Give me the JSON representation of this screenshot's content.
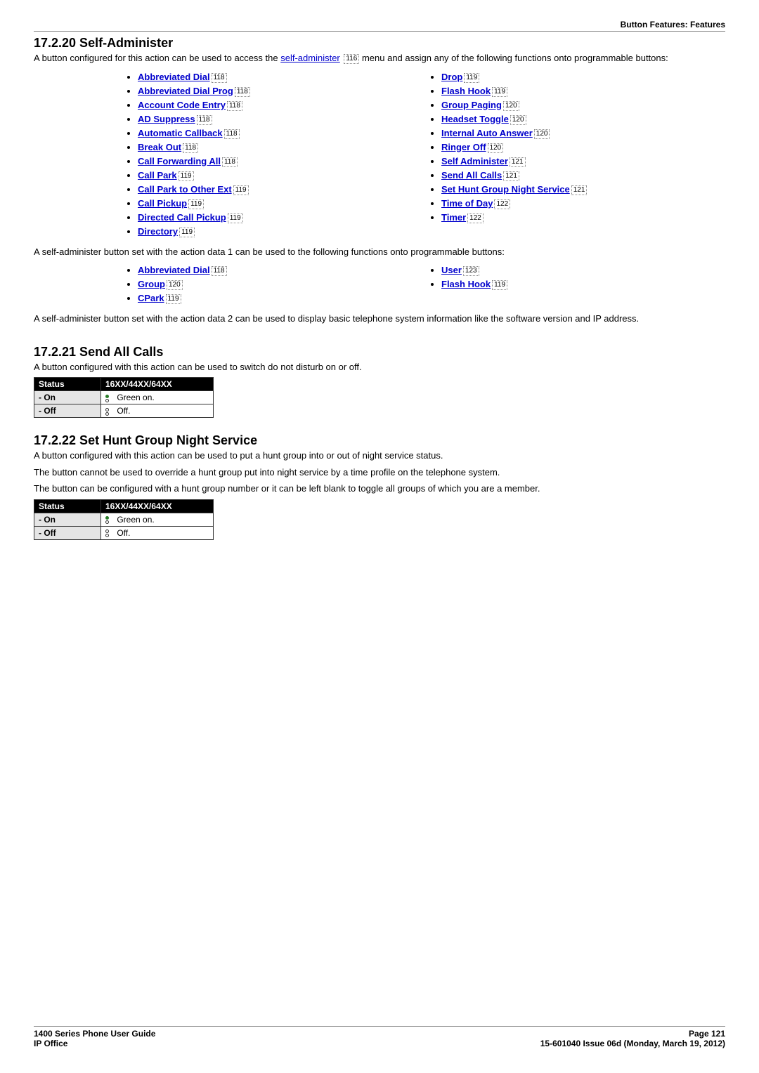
{
  "header": {
    "rightTitle": "Button Features: Features"
  },
  "section_self_admin": {
    "heading": "17.2.20 Self-Administer",
    "intro_pre": "A button configured for this action can be used to access the ",
    "intro_link": "self-administer",
    "intro_link_ref": "116",
    "intro_post": " menu and assign any of the following functions onto programmable buttons:",
    "list_left": [
      {
        "label": "Abbreviated Dial",
        "ref": "118"
      },
      {
        "label": "Abbreviated Dial Prog",
        "ref": "118"
      },
      {
        "label": "Account Code Entry",
        "ref": "118"
      },
      {
        "label": "AD Suppress",
        "ref": "118"
      },
      {
        "label": "Automatic Callback",
        "ref": "118"
      },
      {
        "label": "Break Out",
        "ref": "118"
      },
      {
        "label": "Call Forwarding All",
        "ref": "118"
      },
      {
        "label": "Call Park",
        "ref": "119"
      },
      {
        "label": "Call Park to Other Ext",
        "ref": "119"
      },
      {
        "label": "Call Pickup",
        "ref": "119"
      },
      {
        "label": "Directed Call Pickup",
        "ref": "119"
      },
      {
        "label": "Directory",
        "ref": "119"
      }
    ],
    "list_right": [
      {
        "label": "Drop",
        "ref": "119"
      },
      {
        "label": "Flash Hook",
        "ref": "119"
      },
      {
        "label": "Group Paging",
        "ref": "120"
      },
      {
        "label": "Headset Toggle",
        "ref": "120"
      },
      {
        "label": "Internal Auto Answer",
        "ref": "120"
      },
      {
        "label": "Ringer Off",
        "ref": "120"
      },
      {
        "label": "Self Administer",
        "ref": "121"
      },
      {
        "label": "Send All Calls",
        "ref": "121"
      },
      {
        "label": "Set Hunt Group Night Service",
        "ref": "121"
      },
      {
        "label": "Time of Day",
        "ref": "122"
      },
      {
        "label": "Timer",
        "ref": "122"
      }
    ],
    "mid_text": "A self-administer button set with the action data 1 can be used to the following functions onto programmable buttons:",
    "list2_left": [
      {
        "label": "Abbreviated Dial",
        "ref": "118"
      },
      {
        "label": "Group",
        "ref": "120"
      },
      {
        "label": "CPark",
        "ref": "119"
      }
    ],
    "list2_right": [
      {
        "label": "User",
        "ref": "123"
      },
      {
        "label": "Flash Hook",
        "ref": "119"
      }
    ],
    "end_text": "A self-administer button set with the action data 2 can be used to display basic telephone system information like the software version and IP address."
  },
  "section_sac": {
    "heading": "17.2.21 Send All Calls",
    "intro": "A button configured with this action can be used to switch do not disturb on or off.",
    "table": {
      "header_status": "Status",
      "header_model": "16XX/44XX/64XX",
      "rows": [
        {
          "status": "- On",
          "icon": "green",
          "value": " Green on."
        },
        {
          "status": "- Off",
          "icon": "off",
          "value": " Off."
        }
      ]
    }
  },
  "section_hg": {
    "heading": "17.2.22 Set Hunt Group Night Service",
    "intro": "A button configured with this action can be used to put a hunt group into or out of night service status.",
    "p2": "The button cannot be used to override a hunt group put into night service by a time profile on the telephone system.",
    "p3": "The button can be configured with a hunt group number or it can be left blank to toggle all groups of which you are a member.",
    "table": {
      "header_status": "Status",
      "header_model": "16XX/44XX/64XX",
      "rows": [
        {
          "status": "- On",
          "icon": "green",
          "value": " Green on."
        },
        {
          "status": "- Off",
          "icon": "off",
          "value": " Off."
        }
      ]
    }
  },
  "footer": {
    "leftTop": "1400 Series Phone User Guide",
    "leftBottom": "IP Office",
    "rightTop": "Page 121",
    "rightBottom": "15-601040 Issue 06d (Monday, March 19, 2012)"
  }
}
